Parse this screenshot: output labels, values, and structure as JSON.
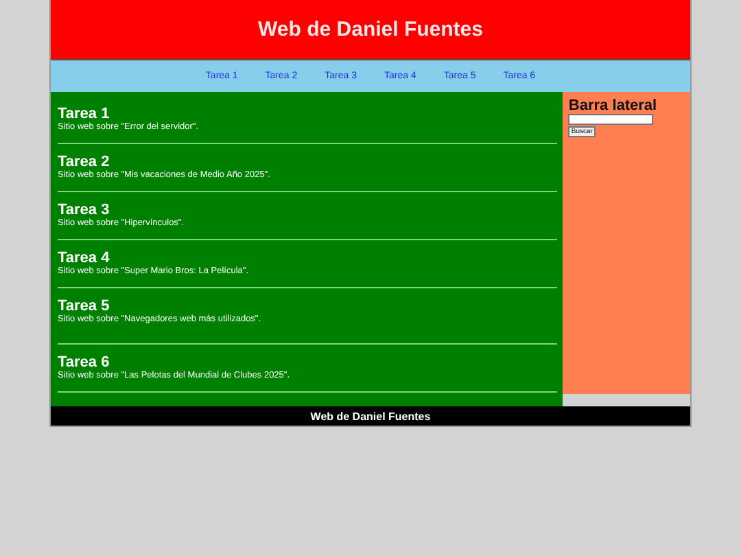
{
  "header": {
    "title": "Web de Daniel Fuentes"
  },
  "nav": [
    "Tarea 1",
    "Tarea 2",
    "Tarea 3",
    "Tarea 4",
    "Tarea 5",
    "Tarea 6"
  ],
  "sections": [
    {
      "title": "Tarea 1",
      "description": "Sitio web sobre \"Error del servidor\"."
    },
    {
      "title": "Tarea 2",
      "description": "Sitio web sobre \"Mis vacaciones de Medio Año 2025\"."
    },
    {
      "title": "Tarea 3",
      "description": "Sitio web sobre \"Hipervínculos\"."
    },
    {
      "title": "Tarea 4",
      "description": "Sitio web sobre \"Super Mario Bros: La Película\"."
    },
    {
      "title": "Tarea 5",
      "description": "Sitio web sobre \"Navegadores web más utilizados\"."
    },
    {
      "title": "Tarea 6",
      "description": "Sitio web sobre \"Las Pelotas del Mundial de Clubes 2025\"."
    }
  ],
  "sidebar": {
    "title": "Barra lateral",
    "button": "Buscar"
  },
  "footer": {
    "text": "Web de Daniel Fuentes"
  }
}
